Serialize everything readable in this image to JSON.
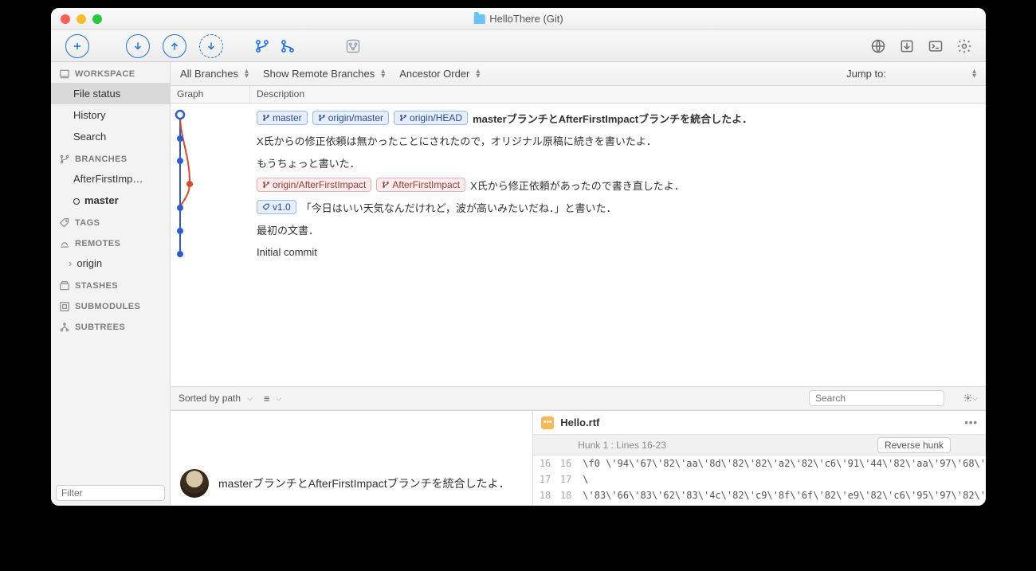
{
  "title": "HelloThere (Git)",
  "filterbar": {
    "branches": "All Branches",
    "remote": "Show Remote Branches",
    "order": "Ancestor Order",
    "jump": "Jump to:"
  },
  "columns": {
    "graph": "Graph",
    "desc": "Description"
  },
  "sidebar": {
    "workspace": {
      "label": "WORKSPACE",
      "file_status": "File status",
      "history": "History",
      "search": "Search"
    },
    "branches": {
      "label": "BRANCHES",
      "items": [
        "AfterFirstImp…",
        "master"
      ]
    },
    "tags": "TAGS",
    "remotes": {
      "label": "REMOTES",
      "items": [
        "origin"
      ]
    },
    "stashes": "STASHES",
    "submodules": "SUBMODULES",
    "subtrees": "SUBTREES",
    "filter_placeholder": "Filter"
  },
  "commits": [
    {
      "badges": [
        {
          "t": "master",
          "c": "blue"
        },
        {
          "t": "origin/master",
          "c": "blue"
        },
        {
          "t": "origin/HEAD",
          "c": "blue"
        }
      ],
      "msg": "masterブランチとAfterFirstImpactブランチを統合したよ．",
      "bold": true
    },
    {
      "badges": [],
      "msg": "X氏からの修正依頼は無かったことにされたので，オリジナル原稿に続きを書いたよ．"
    },
    {
      "badges": [],
      "msg": "もうちょっと書いた．"
    },
    {
      "badges": [
        {
          "t": "origin/AfterFirstImpact",
          "c": "red"
        },
        {
          "t": "AfterFirstImpact",
          "c": "red"
        }
      ],
      "msg": "X氏から修正依頼があったので書き直したよ．"
    },
    {
      "badges": [
        {
          "t": "v1.0",
          "c": "blue",
          "tag": true
        }
      ],
      "msg": "「今日はいい天気なんだけれど，波が高いみたいだね．」と書いた．"
    },
    {
      "badges": [],
      "msg": "最初の文書．"
    },
    {
      "badges": [],
      "msg": "Initial commit"
    }
  ],
  "midbar": {
    "sorted": "Sorted by path",
    "search_placeholder": "Search"
  },
  "detail": {
    "commit_msg": "masterブランチとAfterFirstImpactブランチを統合したよ．",
    "filename": "Hello.rtf",
    "hunk": "Hunk 1 : Lines 16-23",
    "reverse": "Reverse hunk",
    "diff": [
      {
        "a": "16",
        "b": "16",
        "t": "\\f0 \\'94\\'67\\'82\\'aa\\'8d\\'82\\'82\\'a2\\'82\\'c6\\'91\\'44\\'82\\'aa\\'97\\'68\\'"
      },
      {
        "a": "17",
        "b": "17",
        "t": "\\"
      },
      {
        "a": "18",
        "b": "18",
        "t": "\\'83\\'66\\'83\\'62\\'83\\'4c\\'82\\'c9\\'8f\\'6f\\'82\\'e9\\'82\\'c6\\'95\\'97\\'82\\'"
      }
    ]
  }
}
